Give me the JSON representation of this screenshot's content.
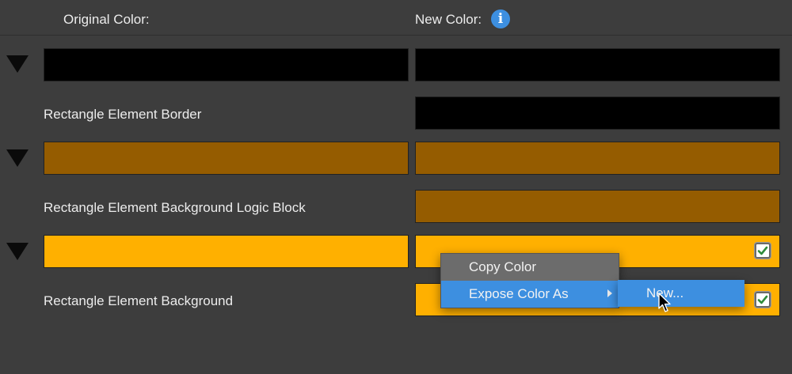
{
  "header": {
    "original_label": "Original Color:",
    "new_label": "New Color:",
    "info_icon_glyph": "i"
  },
  "colors": {
    "black": "#000000",
    "brown": "#955c00",
    "orange": "#ffb000",
    "menu_bg": "#6c6c6c",
    "menu_highlight": "#3d8fe0"
  },
  "rows": [
    {
      "label": "Rectangle Element Border",
      "original_color": "#000000",
      "new_color": "#000000"
    },
    {
      "label": "Rectangle Element Background Logic Block",
      "original_color": "#955c00",
      "new_color": "#955c00"
    },
    {
      "label": "Rectangle Element Background",
      "original_color": "#ffb000",
      "new_color": "#ffb000",
      "checked": true
    }
  ],
  "context_menu": {
    "items": [
      {
        "label": "Copy Color"
      },
      {
        "label": "Expose Color As",
        "has_submenu": true
      }
    ],
    "submenu": {
      "items": [
        {
          "label": "New..."
        }
      ]
    }
  }
}
